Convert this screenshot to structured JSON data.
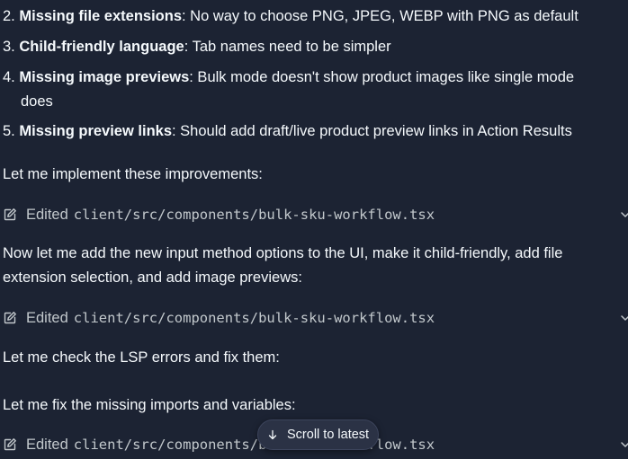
{
  "list": [
    {
      "num": "2.",
      "title": "Missing file extensions",
      "text": ": No way to choose PNG, JPEG, WEBP with PNG as default"
    },
    {
      "num": "3.",
      "title": "Child-friendly language",
      "text": ": Tab names need to be simpler"
    },
    {
      "num": "4.",
      "title": "Missing image previews",
      "text": ": Bulk mode doesn't show product images like single mode",
      "cont": "does"
    },
    {
      "num": "5.",
      "title": "Missing preview links",
      "text": ": Should add draft/live product preview links in Action Results"
    }
  ],
  "messages": {
    "m1": "Let me implement these improvements:",
    "m2a": "Now let me add the new input method options to the UI, make it child-friendly, add file",
    "m2b": "extension selection, and add image previews:",
    "m3": "Let me check the LSP errors and fix them:",
    "m4": "Let me fix the missing imports and variables:"
  },
  "edits": [
    {
      "verb": "Edited",
      "path": "client/src/components/bulk-sku-workflow.tsx"
    },
    {
      "verb": "Edited",
      "path": "client/src/components/bulk-sku-workflow.tsx"
    },
    {
      "verb": "Edited",
      "path": "client/src/components/bulk-sku-workflow.tsx"
    }
  ],
  "scroll_button": {
    "label": "Scroll to latest",
    "icon": "arrow-down-icon"
  },
  "colors": {
    "background": "#1c2333",
    "text": "#f5f9fc",
    "muted": "#c2c8cc",
    "pill": "#2b3245"
  }
}
